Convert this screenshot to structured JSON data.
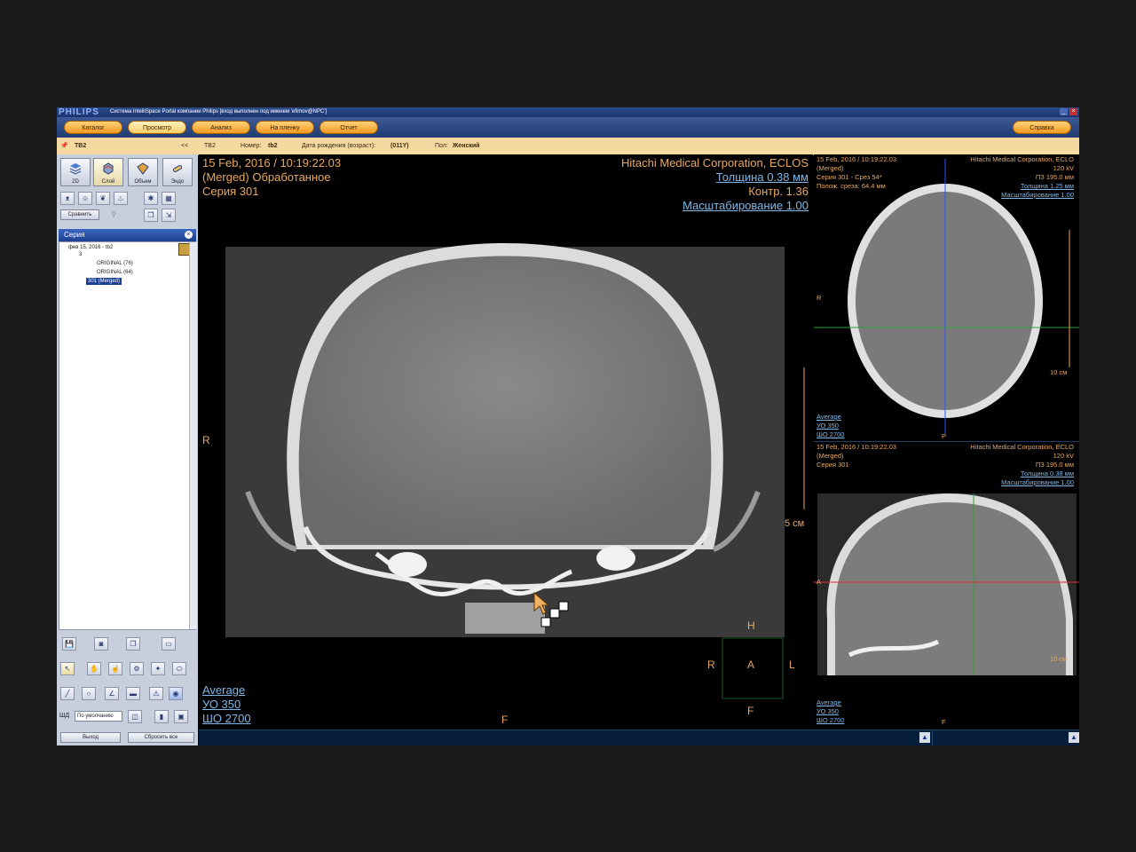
{
  "window": {
    "brand": "PHILIPS",
    "title": "Система IntelliSpace Portal компании Philips [вход выполнен под именем 'efimov@NPC']"
  },
  "nav": {
    "tabs": [
      "Каталог",
      "Просмотр",
      "Анализ",
      "На пленку",
      "Отчет"
    ],
    "active": "Просмотр",
    "help": "Справка"
  },
  "patient": {
    "id": "ТВ2",
    "collapse": "<<",
    "name": "ТВ2",
    "number_label": "Номер:",
    "number": "tb2",
    "dob_label": "Дата рождения (возраст):",
    "dob": "(011Y)",
    "sex_label": "Пол:",
    "sex": "Женский"
  },
  "left": {
    "modes": [
      "2D",
      "Слой",
      "Объем",
      "Эндо"
    ],
    "compare": "Сравнить",
    "series_title": "Серия",
    "tree": [
      "фев 15, 2016 - tb2",
      "3",
      "ORIGINAL (76)",
      "ORIGINAL (64)",
      "301 (Merged)"
    ],
    "wl_label": "ШД",
    "wl_select": "По умолчанию",
    "exit": "Выход",
    "reset": "Сбросить все"
  },
  "main": {
    "top_left": [
      "15 Feb, 2016 / 10:19:22.03",
      "(Merged) Обработанное",
      "Серия 301"
    ],
    "top_right_maker": "Hitachi Medical Corporation, ECLOS",
    "thickness": "Толщина 0.38 мм",
    "contrast": "Контр. 1.36",
    "zoom": "Масштабирование 1.00",
    "orient_left": "R",
    "orient_bottom": "F",
    "scale": "5 см",
    "cube": {
      "top": "H",
      "left": "R",
      "center": "A",
      "right": "L",
      "bottom": "F"
    },
    "bottom_left": [
      "Average",
      "УО   350",
      "ШО  2700"
    ]
  },
  "side_top": {
    "left": [
      "15 Feb, 2016 / 10:19:22.03",
      "(Merged)",
      "Серия 301 - Срез 54*",
      "Полож. среза: 64.4 мм"
    ],
    "right": [
      "Hitachi Medical Corporation, ECLO",
      "120 kV",
      "ПЗ 195.0 мм"
    ],
    "links": [
      "Толщина 1.25 мм",
      "Масштабирование 1.00"
    ],
    "orient_left": "R",
    "orient_bottom": "P",
    "scale": "10 см",
    "bottom": [
      "Average",
      "УО   350",
      "ШО  2700"
    ]
  },
  "side_bottom": {
    "left": [
      "15 Feb, 2016 / 10:19:22.03",
      "(Merged)",
      "Серия 301"
    ],
    "right": [
      "Hitachi Medical Corporation, ECLO",
      "120 kV",
      "ПЗ 195.0 мм"
    ],
    "links": [
      "Толщина 0.38 мм",
      "Масштабирование 1.00"
    ],
    "orient_left": "A",
    "orient_bottom": "F",
    "scale": "10 см",
    "bottom": [
      "Average",
      "УО   350",
      "ШО  2700"
    ]
  },
  "colors": {
    "overlay": "#e8a860",
    "link": "#7fb8e6",
    "accent": "#f39a1f",
    "crosshair_v": "#3050ff",
    "crosshair_h": "#30a040",
    "crosshair_red": "#e03030"
  }
}
